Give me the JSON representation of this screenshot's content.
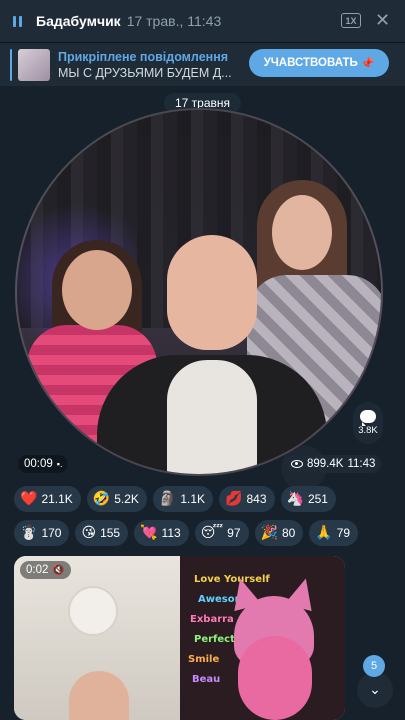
{
  "player": {
    "title": "Бадабумчик",
    "date": "17 трав., 11:43",
    "speed": "1X",
    "close_glyph": "✕"
  },
  "pinned": {
    "title": "Прикріплене повідомлення",
    "text": "МЫ С ДРУЗЬЯМИ БУДЕМ Д...",
    "button_label": "УЧАВСТВОВАТЬ",
    "button_mark": "📌"
  },
  "date_chip": "17 травня",
  "video_message": {
    "duration": "00:09",
    "comments": "3.8K",
    "views": "899.4K",
    "time": "11:43"
  },
  "reactions": [
    [
      {
        "emoji": "❤️",
        "count": "21.1K"
      },
      {
        "emoji": "🤣",
        "count": "5.2K"
      },
      {
        "emoji": "🗿",
        "count": "1.1K"
      },
      {
        "emoji": "💋",
        "count": "843"
      },
      {
        "emoji": "🦄",
        "count": "251"
      }
    ],
    [
      {
        "emoji": "☃️",
        "count": "170"
      },
      {
        "emoji": "😘",
        "count": "155"
      },
      {
        "emoji": "💘",
        "count": "113"
      },
      {
        "emoji": "😴",
        "count": "97"
      },
      {
        "emoji": "🎉",
        "count": "80"
      },
      {
        "emoji": "🙏",
        "count": "79"
      }
    ]
  ],
  "video2": {
    "duration": "0:02",
    "poster_lines": [
      "Love Yourself",
      "Awesome",
      "Exbarra",
      "Perfect",
      "Smile",
      "Beau"
    ]
  },
  "scroll": {
    "unread": "5",
    "icon": "chevron-down-icon"
  },
  "colors": {
    "accent": "#5fa8e6",
    "background": "#16212b",
    "header": "#1f2b36"
  }
}
